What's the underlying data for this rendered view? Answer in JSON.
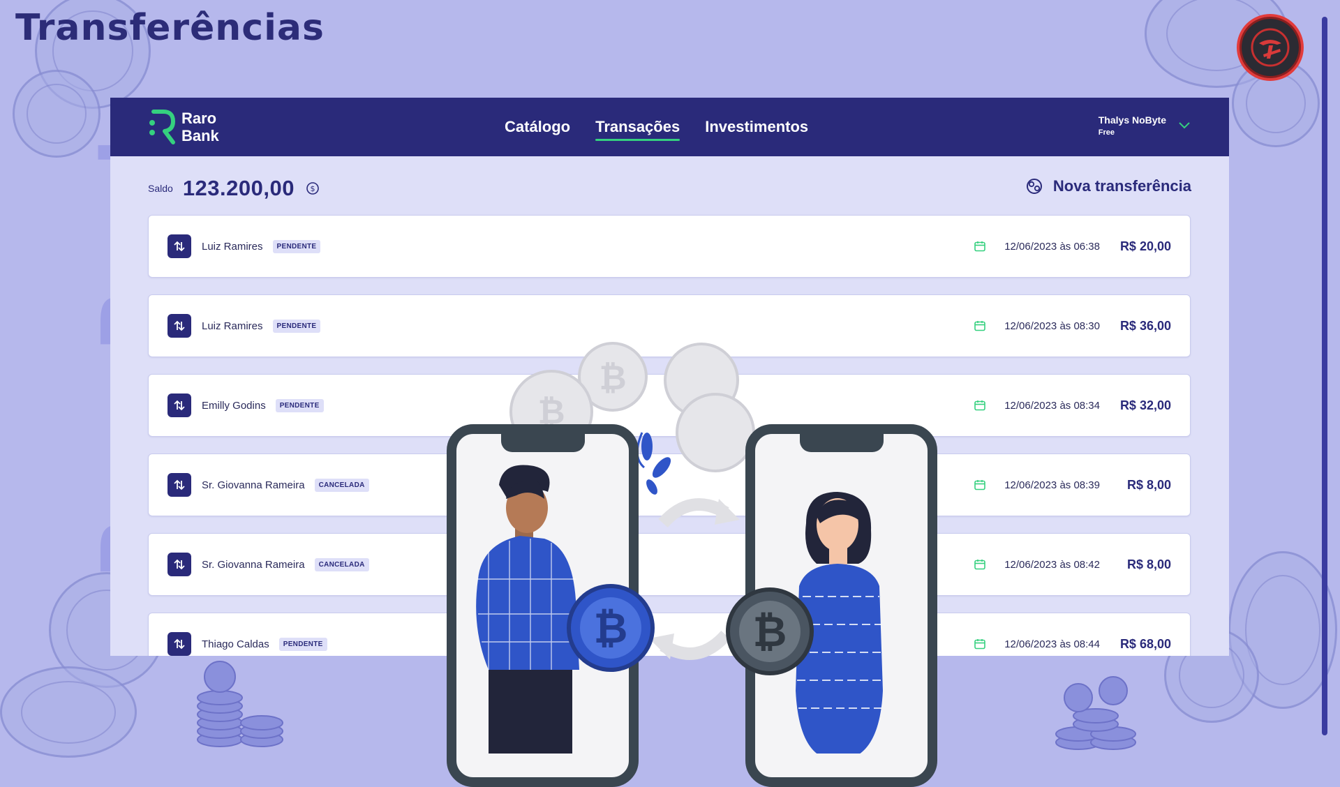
{
  "slide": {
    "title": "Transferências",
    "vertical_brand": "RaroBank"
  },
  "header": {
    "logo_line1": "Raro",
    "logo_line2": "Bank",
    "nav": [
      {
        "label": "Catálogo",
        "active": false
      },
      {
        "label": "Transações",
        "active": true
      },
      {
        "label": "Investimentos",
        "active": false
      }
    ],
    "user_name": "Thalys NoByte",
    "user_plan": "Free"
  },
  "balance": {
    "label": "Saldo",
    "value": "123.200,00",
    "new_transfer_label": "Nova transferência"
  },
  "transactions": [
    {
      "name": "Luiz Ramires",
      "status": "PENDENTE",
      "date": "12/06/2023 às 06:38",
      "amount": "R$ 20,00"
    },
    {
      "name": "Luiz Ramires",
      "status": "PENDENTE",
      "date": "12/06/2023 às 08:30",
      "amount": "R$ 36,00"
    },
    {
      "name": "Emilly Godins",
      "status": "PENDENTE",
      "date": "12/06/2023 às 08:34",
      "amount": "R$ 32,00"
    },
    {
      "name": "Sr. Giovanna Rameira",
      "status": "CANCELADA",
      "date": "12/06/2023 às 08:39",
      "amount": "R$ 8,00"
    },
    {
      "name": "Sr. Giovanna Rameira",
      "status": "CANCELADA",
      "date": "12/06/2023 às 08:42",
      "amount": "R$ 8,00"
    },
    {
      "name": "Thiago Caldas",
      "status": "PENDENTE",
      "date": "12/06/2023 às 08:44",
      "amount": "R$ 68,00"
    }
  ],
  "colors": {
    "background": "#b6b8ec",
    "navy": "#2a2a7a",
    "accent_green": "#35d07f",
    "panel": "#dedff8"
  },
  "icons": {
    "row": "transfer-arrows-icon",
    "date": "calendar-icon",
    "balance": "dollar-circle-icon",
    "new_transfer": "transfer-circle-icon",
    "user_menu": "chevron-down-icon"
  }
}
